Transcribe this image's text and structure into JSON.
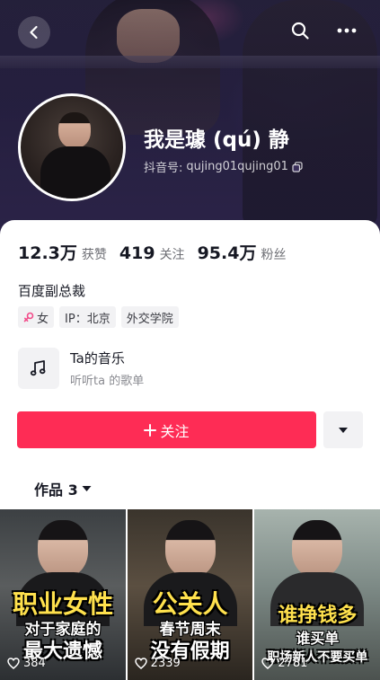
{
  "profile": {
    "nickname": "我是璩 (qú) 静",
    "uid_label": "抖音号:",
    "uid": "qujing01qujing01",
    "bio": "百度副总裁"
  },
  "stats": [
    {
      "value": "12.3万",
      "label": "获赞"
    },
    {
      "value": "419",
      "label": "关注"
    },
    {
      "value": "95.4万",
      "label": "粉丝"
    }
  ],
  "tags": [
    {
      "text": "女",
      "icon": "female-icon"
    },
    {
      "text": "IP：北京"
    },
    {
      "text": "外交学院"
    }
  ],
  "music": {
    "title": "Ta的音乐",
    "subtitle": "听听ta 的歌单",
    "icon": "music-note-icon"
  },
  "actions": {
    "follow_label": "关注",
    "follow_icon": "plus-icon",
    "dropdown_icon": "caret-down-icon"
  },
  "works_tab": {
    "label": "作品 3",
    "icon": "caret-down-icon"
  },
  "videos": [
    {
      "cap_big": "职业女性",
      "cap_mid": "对于家庭的",
      "cap_low": "最大遗憾",
      "likes": "384"
    },
    {
      "cap_big": "公关人",
      "cap_mid": "春节周末",
      "cap_low": "没有假期",
      "likes": "2339"
    },
    {
      "cap_big": "谁挣钱多",
      "cap_mid": "谁买单",
      "cap_low": "职场新人不要买单",
      "likes": "2781"
    }
  ],
  "colors": {
    "accent": "#fe2c55",
    "banner": "#2b2447",
    "tag_bg": "#f2f2f4"
  }
}
